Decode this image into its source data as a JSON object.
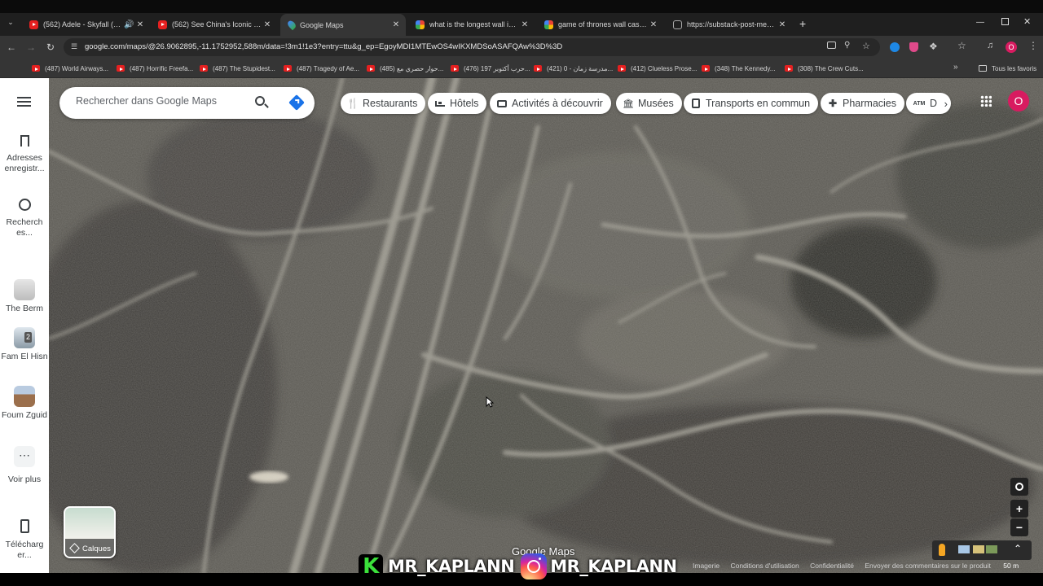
{
  "browser": {
    "tabs": [
      {
        "title": "(562) Adele - Skyfall (Officia",
        "favicon": "youtube-icon"
      },
      {
        "title": "(562) See China's Iconic Great W",
        "favicon": "youtube-icon"
      },
      {
        "title": "Google Maps",
        "favicon": "maps-pin-icon",
        "active": true
      },
      {
        "title": "what is the longest wall in the w",
        "favicon": "google-icon"
      },
      {
        "title": "game of thrones wall castles m",
        "favicon": "google-icon"
      },
      {
        "title": "https://substack-post-media.s3",
        "favicon": "globe-icon"
      }
    ],
    "url": "google.com/maps/@26.9062895,-11.1752952,588m/data=!3m1!1e3?entry=ttu&g_ep=EgoyMDI1MTEwOS4wIKXMDSoASAFQAw%3D%3D",
    "profile_initial": "O",
    "bookmarks": [
      "(487) World Airways...",
      "(487) Horrific Freefa...",
      "(487) The Stupidest...",
      "(487) Tragedy of Ae...",
      "(485) حوار حصري مع...",
      "(476) حرب أكتوبر 197...",
      "(421) مدرسة زمان - 0...",
      "(412) Clueless Prose...",
      "(348) The Kennedy...",
      "(308) The Crew Cuts..."
    ],
    "all_favorites": "Tous les favoris"
  },
  "rail": {
    "saved": "Adresses enregistr...",
    "recent": "Recherch es...",
    "places": [
      {
        "label": "The Berm"
      },
      {
        "label": "Fam El Hisn",
        "badge": "2"
      },
      {
        "label": "Foum Zguid"
      }
    ],
    "more": "Voir plus",
    "download": "Télécharg er..."
  },
  "search": {
    "placeholder": "Rechercher dans Google Maps"
  },
  "chips": [
    {
      "label": "Restaurants",
      "icon": "fork-knife-icon"
    },
    {
      "label": "Hôtels",
      "icon": "bed-icon"
    },
    {
      "label": "Activités à découvrir",
      "icon": "camera-icon"
    },
    {
      "label": "Musées",
      "icon": "museum-icon"
    },
    {
      "label": "Transports en commun",
      "icon": "bus-icon"
    },
    {
      "label": "Pharmacies",
      "icon": "pharmacy-icon"
    },
    {
      "label": "D",
      "icon": "atm-icon"
    }
  ],
  "layers": {
    "label": "Calques"
  },
  "map": {
    "brand": "Google Maps",
    "scale": "50 m"
  },
  "footer": {
    "links": [
      "Imagerie",
      "Conditions d'utilisation",
      "Confidentialité",
      "Envoyer des commentaires sur le produit"
    ]
  },
  "watermark": {
    "handle1": "MR_KAPLANN",
    "handle2": "MR_KAPLANN"
  },
  "colors": {
    "accent": "#1a73e8",
    "profile": "#d81b60"
  }
}
